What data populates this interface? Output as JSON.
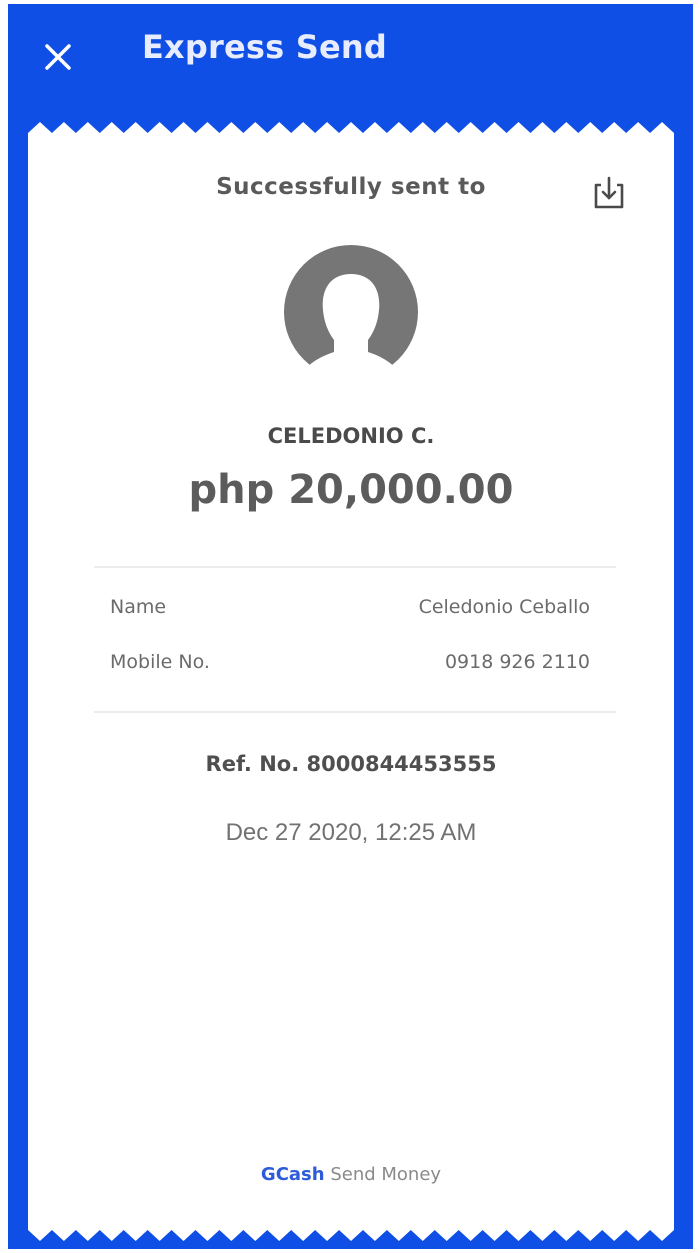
{
  "header": {
    "title": "Express Send",
    "close_icon": "close-icon"
  },
  "receipt": {
    "sent_label": "Successfully sent to",
    "download_icon": "download-icon",
    "avatar_icon": "user-avatar-icon",
    "recipient_short": "CELEDONIO C.",
    "amount": "php 20,000.00",
    "details": {
      "name_label": "Name",
      "name_value": "Celedonio Ceballo",
      "mobile_label": "Mobile No.",
      "mobile_value": "0918 926 2110"
    },
    "ref_no": "Ref. No. 8000844453555",
    "timestamp": "Dec 27 2020, 12:25 AM",
    "footer": {
      "brand": "GCash",
      "text": "Send Money"
    }
  },
  "colors": {
    "brand_blue": "#0f4fe6",
    "header_text": "#e7ecff",
    "paper": "#ffffff",
    "avatar_gray": "#767676"
  }
}
